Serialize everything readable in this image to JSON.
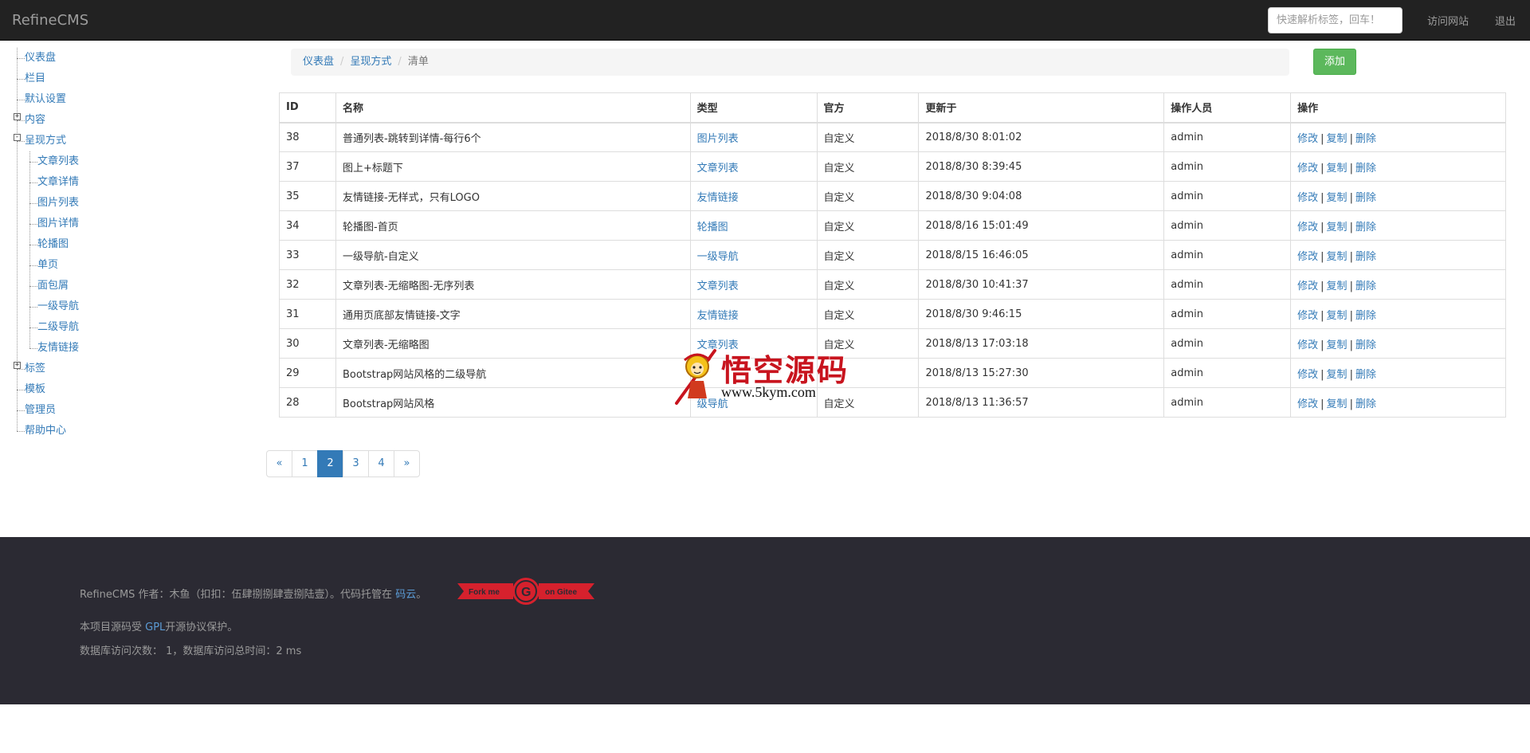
{
  "navbar": {
    "brand": "RefineCMS",
    "search_placeholder": "快速解析标签，回车！",
    "visit_site": "访问网站",
    "logout": "退出"
  },
  "sidebar": {
    "items": [
      {
        "label": "仪表盘",
        "level": 0
      },
      {
        "label": "栏目",
        "level": 0
      },
      {
        "label": "默认设置",
        "level": 0
      },
      {
        "label": "内容",
        "level": 0,
        "toggle": "+"
      },
      {
        "label": "呈现方式",
        "level": 0,
        "toggle": "-"
      },
      {
        "label": "文章列表",
        "level": 1
      },
      {
        "label": "文章详情",
        "level": 1
      },
      {
        "label": "图片列表",
        "level": 1
      },
      {
        "label": "图片详情",
        "level": 1
      },
      {
        "label": "轮播图",
        "level": 1
      },
      {
        "label": "单页",
        "level": 1
      },
      {
        "label": "面包屑",
        "level": 1
      },
      {
        "label": "一级导航",
        "level": 1
      },
      {
        "label": "二级导航",
        "level": 1
      },
      {
        "label": "友情链接",
        "level": 1
      },
      {
        "label": "标签",
        "level": 0,
        "toggle": "+"
      },
      {
        "label": "模板",
        "level": 0
      },
      {
        "label": "管理员",
        "level": 0
      },
      {
        "label": "帮助中心",
        "level": 0
      }
    ]
  },
  "breadcrumb": {
    "items": [
      "仪表盘",
      "呈现方式",
      "清单"
    ]
  },
  "add_button": "添加",
  "table": {
    "headers": [
      "ID",
      "名称",
      "类型",
      "官方",
      "更新于",
      "操作人员",
      "操作"
    ],
    "rows": [
      {
        "id": "38",
        "name": "普通列表-跳转到详情-每行6个",
        "type": "图片列表",
        "official": "自定义",
        "updated": "2018/8/30 8:01:02",
        "operator": "admin"
      },
      {
        "id": "37",
        "name": "图上+标题下",
        "type": "文章列表",
        "official": "自定义",
        "updated": "2018/8/30 8:39:45",
        "operator": "admin"
      },
      {
        "id": "35",
        "name": "友情链接-无样式，只有LOGO",
        "type": "友情链接",
        "official": "自定义",
        "updated": "2018/8/30 9:04:08",
        "operator": "admin"
      },
      {
        "id": "34",
        "name": "轮播图-首页",
        "type": "轮播图",
        "official": "自定义",
        "updated": "2018/8/16 15:01:49",
        "operator": "admin"
      },
      {
        "id": "33",
        "name": "一级导航-自定义",
        "type": "一级导航",
        "official": "自定义",
        "updated": "2018/8/15 16:46:05",
        "operator": "admin"
      },
      {
        "id": "32",
        "name": "文章列表-无缩略图-无序列表",
        "type": "文章列表",
        "official": "自定义",
        "updated": "2018/8/30 10:41:37",
        "operator": "admin"
      },
      {
        "id": "31",
        "name": "通用页底部友情链接-文字",
        "type": "友情链接",
        "official": "自定义",
        "updated": "2018/8/30 9:46:15",
        "operator": "admin"
      },
      {
        "id": "30",
        "name": "文章列表-无缩略图",
        "type": "文章列表",
        "official": "自定义",
        "updated": "2018/8/13 17:03:18",
        "operator": "admin"
      },
      {
        "id": "29",
        "name": "Bootstrap网站风格的二级导航",
        "type": "",
        "official": "",
        "updated": "2018/8/13 15:27:30",
        "operator": "admin"
      },
      {
        "id": "28",
        "name": "Bootstrap网站风格",
        "type": "级导航",
        "official": "自定义",
        "updated": "2018/8/13 11:36:57",
        "operator": "admin"
      }
    ],
    "actions": {
      "edit": "修改",
      "copy": "复制",
      "delete": "删除",
      "separator": "|"
    }
  },
  "pagination": {
    "prev": "«",
    "pages": [
      "1",
      "2",
      "3",
      "4"
    ],
    "current": "2",
    "next": "»"
  },
  "watermark": {
    "title": "悟空源码",
    "url": "www.5kym.com"
  },
  "footer": {
    "line1_prefix": "RefineCMS 作者：木鱼（扣扣：伍肆捌捌肆壹捌陆壹）。代码托管在 ",
    "line1_link": "码云",
    "line1_suffix": "。",
    "ribbon_left": "Fork me",
    "ribbon_right": "on Gitee",
    "ribbon_logo": "G",
    "line2_prefix": "本项目源码受 ",
    "line2_link": "GPL",
    "line2_suffix": "开源协议保护。",
    "line3": "数据库访问次数： 1，数据库访问总时间：2 ms"
  },
  "colors": {
    "navbar_bg": "#222222",
    "link": "#337ab7",
    "add_button": "#5cb85c",
    "footer_bg": "#2b2a33",
    "ribbon": "#d6212d"
  }
}
